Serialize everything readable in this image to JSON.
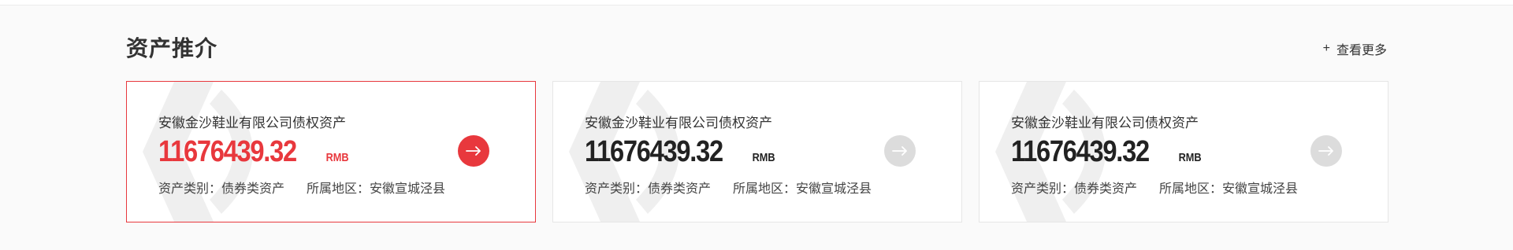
{
  "section": {
    "title": "资产推介",
    "view_more": "查看更多",
    "plus": "+"
  },
  "cards": [
    {
      "name": "安徽金沙鞋业有限公司债权资产",
      "amount": "11676439.32",
      "unit": "RMB",
      "category": "资产类别：债券类资产",
      "region": "所属地区：安徽宣城泾县",
      "active": true
    },
    {
      "name": "安徽金沙鞋业有限公司债权资产",
      "amount": "11676439.32",
      "unit": "RMB",
      "category": "资产类别：债券类资产",
      "region": "所属地区：安徽宣城泾县",
      "active": false
    },
    {
      "name": "安徽金沙鞋业有限公司债权资产",
      "amount": "11676439.32",
      "unit": "RMB",
      "category": "资产类别：债券类资产",
      "region": "所属地区：安徽宣城泾县",
      "active": false
    }
  ],
  "colors": {
    "accent": "#e8383d",
    "arrow_inactive": "#dcdcdc",
    "text": "#333333"
  },
  "icons": {
    "arrow": "arrow-right-icon",
    "plus": "plus-icon"
  }
}
